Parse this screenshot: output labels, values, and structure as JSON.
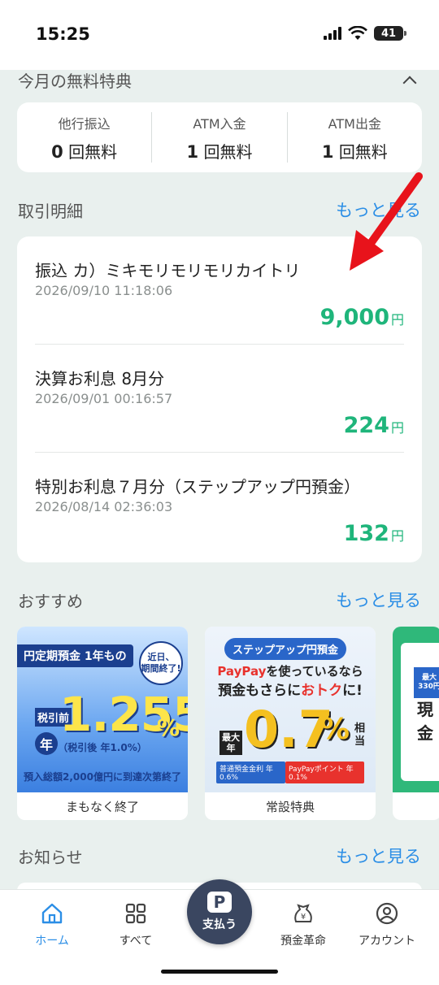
{
  "status_bar": {
    "time": "15:25",
    "battery": "41"
  },
  "free_benefits": {
    "title": "今月の無料特典",
    "items": [
      {
        "label": "他行振込",
        "count": "0",
        "suffix": "回無料"
      },
      {
        "label": "ATM入金",
        "count": "1",
        "suffix": "回無料"
      },
      {
        "label": "ATM出金",
        "count": "1",
        "suffix": "回無料"
      }
    ]
  },
  "transactions": {
    "title": "取引明細",
    "more": "もっと見る",
    "items": [
      {
        "title": "振込 カ）ミキモリモリモリカイトリ",
        "date": "2026/09/10 11:18:06",
        "amount": "9,000",
        "unit": "円"
      },
      {
        "title": "決算お利息 8月分",
        "date": "2026/09/01 00:16:57",
        "amount": "224",
        "unit": "円"
      },
      {
        "title": "特別お利息７月分（ステップアップ円預金）",
        "date": "2026/08/14 02:36:03",
        "amount": "132",
        "unit": "円"
      }
    ]
  },
  "recommend": {
    "title": "おすすめ",
    "more": "もっと見る",
    "cards": [
      {
        "tag": "円定期預金 1年もの",
        "soon": "近日、\n期間終了!",
        "rate_pre": "税引前",
        "rate_nen": "年",
        "rate": "1.255",
        "rate_unit": "%",
        "after": "（税引後 年1.0%）",
        "limit": "預入総額2,000億円に到達次第終了",
        "caption": "まもなく終了"
      },
      {
        "tag": "ステップアップ円預金",
        "line1_a": "PayPay",
        "line1_b": "を使っているなら",
        "line2_a": "預金もさらに",
        "line2_b": "おトク",
        "line2_c": "に!",
        "max": "最大年",
        "rate": "0.7",
        "rate_unit": "%",
        "equiv": "相当",
        "split_a": "普通預金金利 年0.6%",
        "split_b": "PayPayポイント 年0.1%",
        "caption": "常設特典"
      },
      {
        "badge": "最大\n330円",
        "cash": "現金"
      }
    ]
  },
  "notices": {
    "title": "お知らせ",
    "more": "もっと見る"
  },
  "tabbar": {
    "home": "ホーム",
    "all": "すべて",
    "pay": "支払う",
    "pay_logo": "P",
    "savings": "預金革命",
    "account": "アカウント",
    "active_color": "#2b8ee6"
  },
  "colors": {
    "amount_green": "#1fb57b",
    "link_blue": "#2b8ee6",
    "annotation_red": "#e8131b"
  }
}
